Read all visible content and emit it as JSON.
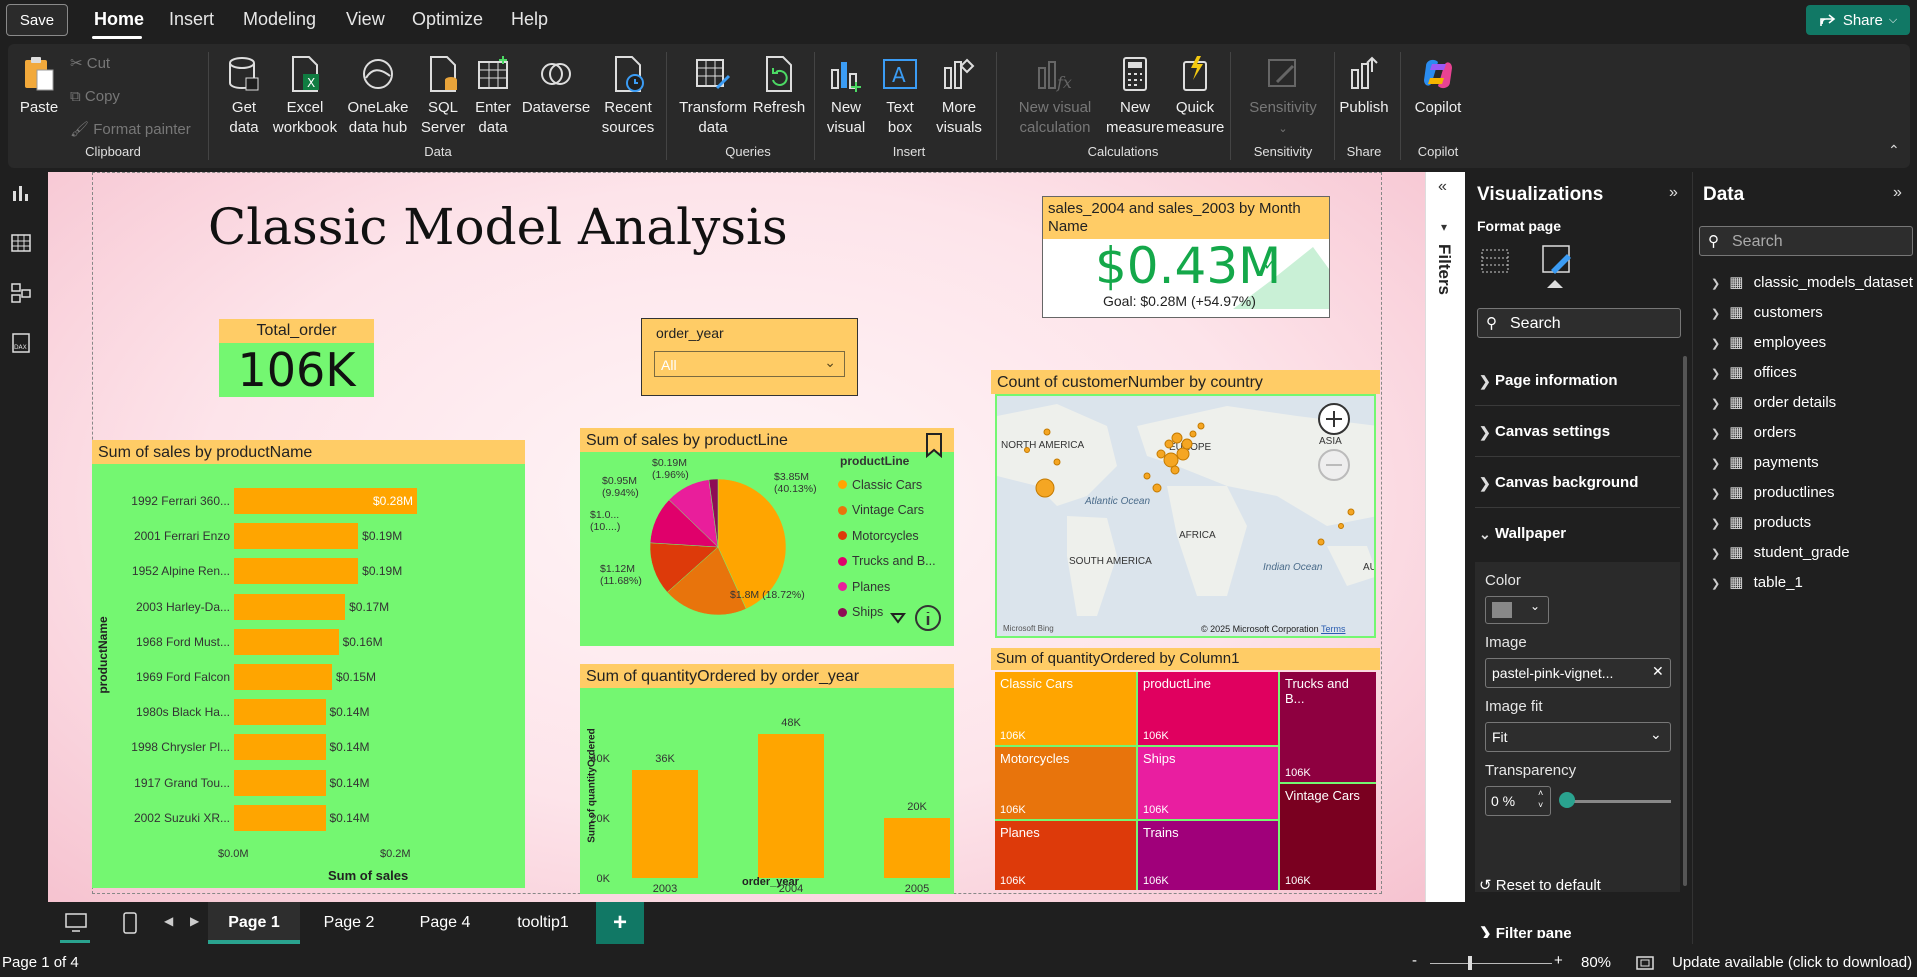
{
  "topbar": {
    "save_label": "Save",
    "tabs": [
      "Home",
      "Insert",
      "Modeling",
      "View",
      "Optimize",
      "Help"
    ],
    "share_label": "Share"
  },
  "ribbon": {
    "clipboard": {
      "paste": "Paste",
      "cut": "Cut",
      "copy": "Copy",
      "format_painter": "Format painter",
      "group": "Clipboard"
    },
    "data": {
      "get_data": [
        "Get",
        "data"
      ],
      "excel": [
        "Excel",
        "workbook"
      ],
      "onelake": [
        "OneLake",
        "data hub"
      ],
      "sql": [
        "SQL",
        "Server"
      ],
      "enter": [
        "Enter",
        "data"
      ],
      "dataverse": "Dataverse",
      "recent": [
        "Recent",
        "sources"
      ],
      "group": "Data"
    },
    "queries": {
      "transform": [
        "Transform",
        "data"
      ],
      "refresh": "Refresh",
      "group": "Queries"
    },
    "insert": {
      "new_visual": [
        "New",
        "visual"
      ],
      "text_box": [
        "Text",
        "box"
      ],
      "more_visuals": [
        "More",
        "visuals"
      ],
      "group": "Insert"
    },
    "calculations": {
      "new_visual_calc": [
        "New visual",
        "calculation"
      ],
      "new_measure": [
        "New",
        "measure"
      ],
      "quick_measure": [
        "Quick",
        "measure"
      ],
      "group": "Calculations"
    },
    "sensitivity": {
      "label": "Sensitivity",
      "group": "Sensitivity"
    },
    "share": {
      "publish": "Publish",
      "group": "Share"
    },
    "copilot": {
      "label": "Copilot",
      "group": "Copilot"
    }
  },
  "report": {
    "title": "Classic Model Analysis",
    "total_order": {
      "title": "Total_order",
      "value": "106K"
    },
    "slicer": {
      "title": "order_year",
      "value": "All"
    },
    "kpi": {
      "title": "sales_2004 and sales_2003 by Month Name",
      "value": "$0.43M",
      "goal": "Goal: $0.28M (+54.97%)"
    }
  },
  "chart_data": [
    {
      "type": "bar",
      "title": "Sum of sales by productName",
      "xlabel": "Sum of sales",
      "ylabel": "productName",
      "categories": [
        "1992 Ferrari 360...",
        "2001 Ferrari Enzo",
        "1952 Alpine Ren...",
        "2003 Harley-Da...",
        "1968 Ford Must...",
        "1969 Ford Falcon",
        "1980s Black Ha...",
        "1998 Chrysler Pl...",
        "1917 Grand Tou...",
        "2002 Suzuki XR..."
      ],
      "values": [
        0.28,
        0.19,
        0.19,
        0.17,
        0.16,
        0.15,
        0.14,
        0.14,
        0.14,
        0.14
      ],
      "labels": [
        "$0.28M",
        "$0.19M",
        "$0.19M",
        "$0.17M",
        "$0.16M",
        "$0.15M",
        "$0.14M",
        "$0.14M",
        "$0.14M",
        "$0.14M"
      ],
      "x_ticks": [
        "$0.0M",
        "$0.2M"
      ],
      "xlim": [
        0,
        0.3
      ]
    },
    {
      "type": "pie",
      "title": "Sum of sales by productLine",
      "legend_title": "productLine",
      "categories": [
        "Classic Cars",
        "Vintage Cars",
        "Motorcycles",
        "Trucks and B...",
        "Planes",
        "Ships"
      ],
      "values": [
        3.85,
        1.8,
        1.12,
        1.0,
        0.95,
        0.19
      ],
      "colors": [
        "#ffa500",
        "#e8740c",
        "#dd3a0a",
        "#e0006b",
        "#e91e9b",
        "#8e0c55"
      ],
      "data_labels": [
        "$3.85M\n(40.13%)",
        "$1.8M (18.72%)",
        "$1.12M\n(11.68%)",
        "$1.0...\n(10....)",
        "$0.95M\n(9.94%)",
        "$0.19M\n(1.96%)"
      ]
    },
    {
      "type": "bar",
      "title": "Sum of quantityOrdered by order_year",
      "xlabel": "order_year",
      "ylabel": "Sum of quantityOrdered",
      "categories": [
        "2003",
        "2004",
        "2005"
      ],
      "values": [
        36,
        48,
        20
      ],
      "labels": [
        "36K",
        "48K",
        "20K"
      ],
      "y_ticks": [
        "0K",
        "20K",
        "40K"
      ],
      "ylim": [
        0,
        50
      ]
    },
    {
      "type": "heatmap",
      "title": "Sum of quantityOrdered by Column1",
      "categories": [
        "Classic Cars",
        "productLine",
        "Trucks and B...",
        "Motorcycles",
        "Ships",
        "Vintage Cars",
        "Planes",
        "Trains"
      ],
      "labels": [
        "106K",
        "106K",
        "106K",
        "106K",
        "106K",
        "106K",
        "106K",
        "106K"
      ],
      "colors": [
        "#ffa500",
        "#e0005f",
        "#8e0040",
        "#e8740c",
        "#e91ea0",
        "#7a0020",
        "#dd3a0a",
        "#a0007a"
      ]
    }
  ],
  "map": {
    "title": "Count of customerNumber by country",
    "labels": [
      "NORTH AMERICA",
      "EUROPE",
      "ASIA",
      "Atlantic Ocean",
      "AFRICA",
      "SOUTH AMERICA",
      "Indian Ocean",
      "AU"
    ],
    "attribution": "© 2025 Microsoft Corporation",
    "terms": "Terms",
    "bing": "Microsoft Bing"
  },
  "filters_label": "Filters",
  "viz_pane": {
    "title": "Visualizations",
    "subtitle": "Format page",
    "search_placeholder": "Search",
    "sections": [
      "Page information",
      "Canvas settings",
      "Canvas background",
      "Wallpaper"
    ],
    "wallpaper": {
      "color_label": "Color",
      "image_label": "Image",
      "image_value": "pastel-pink-vignet...",
      "fit_label": "Image fit",
      "fit_value": "Fit",
      "transparency_label": "Transparency",
      "transparency_value": "0 %",
      "transparency": 0
    },
    "reset": "Reset to default",
    "filter_pane": "Filter pane"
  },
  "data_pane": {
    "title": "Data",
    "search_placeholder": "Search",
    "tables": [
      "classic_models_dataset",
      "customers",
      "employees",
      "offices",
      "order details",
      "orders",
      "payments",
      "productlines",
      "products",
      "student_grade",
      "table_1"
    ]
  },
  "pages": {
    "tabs": [
      "Page 1",
      "Page 2",
      "Page 4",
      "tooltip1"
    ],
    "active": "Page 1",
    "add": "+"
  },
  "status": {
    "page": "Page 1 of 4",
    "zoom": "80%",
    "update": "Update available (click to download)",
    "minus": "-",
    "plus": "+"
  },
  "colors": {
    "accent": "#117865",
    "header_fill": "#ffcc66",
    "visual_fill": "#74f771",
    "bar": "#ffa500"
  }
}
